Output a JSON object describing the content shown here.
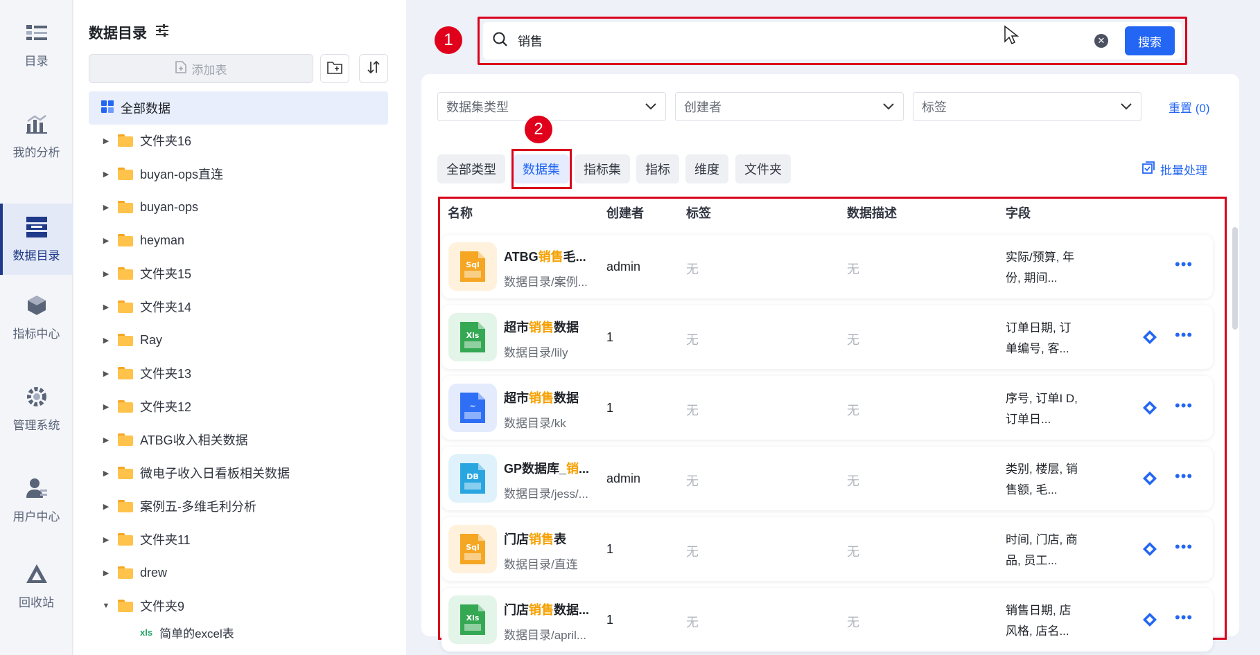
{
  "nav": [
    {
      "label": "目录",
      "icon": "list-icon"
    },
    {
      "label": "我的分析",
      "icon": "bar-chart-icon"
    },
    {
      "label": "数据目录",
      "icon": "database-icon",
      "active": true
    },
    {
      "label": "指标中心",
      "icon": "cube-icon"
    },
    {
      "label": "管理系统",
      "icon": "gear-icon"
    },
    {
      "label": "用户中心",
      "icon": "user-icon"
    },
    {
      "label": "回收站",
      "icon": "recycle-icon"
    }
  ],
  "tree": {
    "title": "数据目录",
    "add_table": "添加表",
    "all_data": "全部数据",
    "folders": [
      "文件夹16",
      "buyan-ops直连",
      "buyan-ops",
      "heyman",
      "文件夹15",
      "文件夹14",
      "Ray",
      "文件夹13",
      "文件夹12",
      "ATBG收入相关数据",
      "微电子收入日看板相关数据",
      "案例五-多维毛利分析",
      "文件夹11",
      "drew",
      "文件夹9"
    ],
    "child_partial": "简单的excel表"
  },
  "search": {
    "value": "销售",
    "button": "搜索"
  },
  "badges": {
    "one": "1",
    "two": "2"
  },
  "filters": {
    "dataset_type": "数据集类型",
    "creator": "创建者",
    "tag": "标签",
    "reset": "重置 (0)"
  },
  "chips": [
    "全部类型",
    "数据集",
    "指标集",
    "指标",
    "维度",
    "文件夹"
  ],
  "batch": "批量处理",
  "columns": {
    "name": "名称",
    "creator": "创建者",
    "tag": "标签",
    "desc": "数据描述",
    "fields": "字段"
  },
  "rows": [
    {
      "pre": "ATBG",
      "hl": "销售",
      "post": "毛...",
      "path": "数据目录/案例...",
      "creator": "admin",
      "tag": "无",
      "desc": "无",
      "fields": "实际/预算, 年份, 期间...",
      "type": "sql"
    },
    {
      "pre": "超市",
      "hl": "销售",
      "post": "数据",
      "path": "数据目录/lily",
      "creator": "1",
      "tag": "无",
      "desc": "无",
      "fields": "订单日期, 订单编号, 客...",
      "type": "xls"
    },
    {
      "pre": "超市",
      "hl": "销售",
      "post": "数据",
      "path": "数据目录/kk",
      "creator": "1",
      "tag": "无",
      "desc": "无",
      "fields": "序号, 订单I D, 订单日...",
      "type": "chart"
    },
    {
      "pre": "GP数据库_",
      "hl": "销",
      "post": "...",
      "path": "数据目录/jess/...",
      "creator": "admin",
      "tag": "无",
      "desc": "无",
      "fields": "类别, 楼层, 销售额, 毛...",
      "type": "db"
    },
    {
      "pre": "门店",
      "hl": "销售",
      "post": "表",
      "path": "数据目录/直连",
      "creator": "1",
      "tag": "无",
      "desc": "无",
      "fields": "时间, 门店, 商品, 员工...",
      "type": "sql"
    },
    {
      "pre": "门店",
      "hl": "销售",
      "post": "数据...",
      "path": "数据目录/april...",
      "creator": "1",
      "tag": "无",
      "desc": "无",
      "fields": "销售日期, 店风格, 店名...",
      "type": "xls"
    }
  ]
}
